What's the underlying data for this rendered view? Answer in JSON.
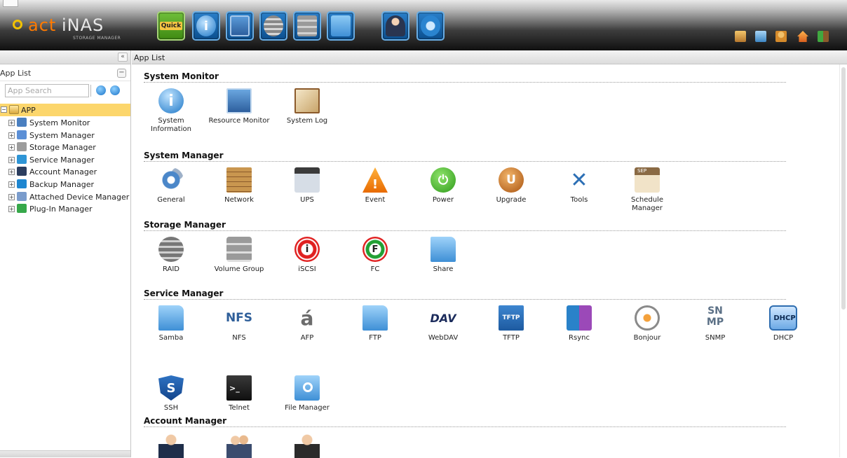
{
  "header": {
    "logo": {
      "brand_a": "act",
      "brand_b": "iNAS",
      "subtitle": "STORAGE MANAGER"
    },
    "toolbar_buttons": [
      {
        "icon": "quick-icon",
        "label": "Quick"
      },
      {
        "icon": "info-icon"
      },
      {
        "icon": "resource-monitor-icon"
      },
      {
        "icon": "raid-icon"
      },
      {
        "icon": "volume-group-icon"
      },
      {
        "icon": "share-icon"
      },
      {
        "icon": "account-icon"
      },
      {
        "icon": "backup-icon"
      }
    ],
    "tray_icons": [
      "note-icon",
      "display-icon",
      "user-group-icon",
      "home-icon",
      "logout-icon"
    ]
  },
  "left_panel": {
    "collapse_glyph": "«",
    "title": "App List",
    "minus_glyph": "−",
    "search": {
      "placeholder": "App Search",
      "value": ""
    },
    "tree": {
      "root": {
        "label": "APP",
        "icon": "folder-app-icon"
      },
      "items": [
        {
          "label": "System Monitor",
          "icon": "monitor-icon",
          "color": "#4a7fc0"
        },
        {
          "label": "System Manager",
          "icon": "system-manager-icon",
          "color": "#5b8fd6"
        },
        {
          "label": "Storage Manager",
          "icon": "storage-manager-icon",
          "color": "#9c9c9c"
        },
        {
          "label": "Service Manager",
          "icon": "service-manager-icon",
          "color": "#2e95d6"
        },
        {
          "label": "Account Manager",
          "icon": "account-manager-icon",
          "color": "#2c3e5f"
        },
        {
          "label": "Backup Manager",
          "icon": "backup-manager-icon",
          "color": "#1e86d0"
        },
        {
          "label": "Attached Device Manager",
          "icon": "attached-device-icon",
          "color": "#7a9ccc"
        },
        {
          "label": "Plug-In Manager",
          "icon": "plugin-manager-icon",
          "color": "#36a84a"
        }
      ]
    }
  },
  "main": {
    "title": "App List",
    "sections": [
      {
        "title": "System Monitor",
        "apps": [
          {
            "label": "System Information",
            "label_line1": "System",
            "label_line2": "Information",
            "icon": "system-information-icon"
          },
          {
            "label": "Resource Monitor",
            "icon": "resource-monitor-icon"
          },
          {
            "label": "System Log",
            "icon": "system-log-icon"
          }
        ]
      },
      {
        "title": "System Manager",
        "apps": [
          {
            "label": "General",
            "icon": "gears-icon"
          },
          {
            "label": "Network",
            "icon": "network-wall-icon"
          },
          {
            "label": "UPS",
            "icon": "ups-icon"
          },
          {
            "label": "Event",
            "icon": "warning-icon"
          },
          {
            "label": "Power",
            "icon": "power-icon"
          },
          {
            "label": "Upgrade",
            "icon": "upgrade-icon"
          },
          {
            "label": "Tools",
            "icon": "tools-icon"
          },
          {
            "label": "Schedule Manager",
            "icon": "calendar-icon",
            "badge": "SEP"
          }
        ]
      },
      {
        "title": "Storage Manager",
        "apps": [
          {
            "label": "RAID",
            "icon": "raid-disks-icon"
          },
          {
            "label": "Volume Group",
            "icon": "volume-group-icon"
          },
          {
            "label": "iSCSI",
            "icon": "iscsi-target-icon",
            "glyph": "i"
          },
          {
            "label": "FC",
            "icon": "fc-target-icon",
            "glyph": "F"
          },
          {
            "label": "Share",
            "icon": "share-folder-icon"
          }
        ]
      },
      {
        "title": "Service Manager",
        "apps": [
          {
            "label": "Samba",
            "icon": "samba-folder-icon"
          },
          {
            "label": "NFS",
            "icon": "nfs-icon",
            "glyph": "NFS"
          },
          {
            "label": "AFP",
            "icon": "afp-apple-icon",
            "glyph": "á"
          },
          {
            "label": "FTP",
            "icon": "ftp-folder-icon"
          },
          {
            "label": "WebDAV",
            "icon": "webdav-icon",
            "glyph": "DAV"
          },
          {
            "label": "TFTP",
            "icon": "tftp-icon",
            "glyph": "TFTP"
          },
          {
            "label": "Rsync",
            "icon": "rsync-icon"
          },
          {
            "label": "Bonjour",
            "icon": "bonjour-icon"
          },
          {
            "label": "SNMP",
            "icon": "snmp-icon",
            "glyph_top": "SN",
            "glyph_bottom": "MP"
          },
          {
            "label": "DHCP",
            "icon": "dhcp-icon",
            "glyph": "DHCP"
          },
          {
            "label": "SSH",
            "icon": "ssh-shield-icon",
            "glyph": "S"
          },
          {
            "label": "Telnet",
            "icon": "terminal-icon",
            "glyph": ">_"
          },
          {
            "label": "File Manager",
            "icon": "file-manager-icon"
          }
        ]
      },
      {
        "title": "Account Manager",
        "apps": [
          {
            "icon": "user-icon"
          },
          {
            "icon": "group-icon"
          },
          {
            "icon": "domain-user-icon"
          }
        ]
      }
    ]
  }
}
